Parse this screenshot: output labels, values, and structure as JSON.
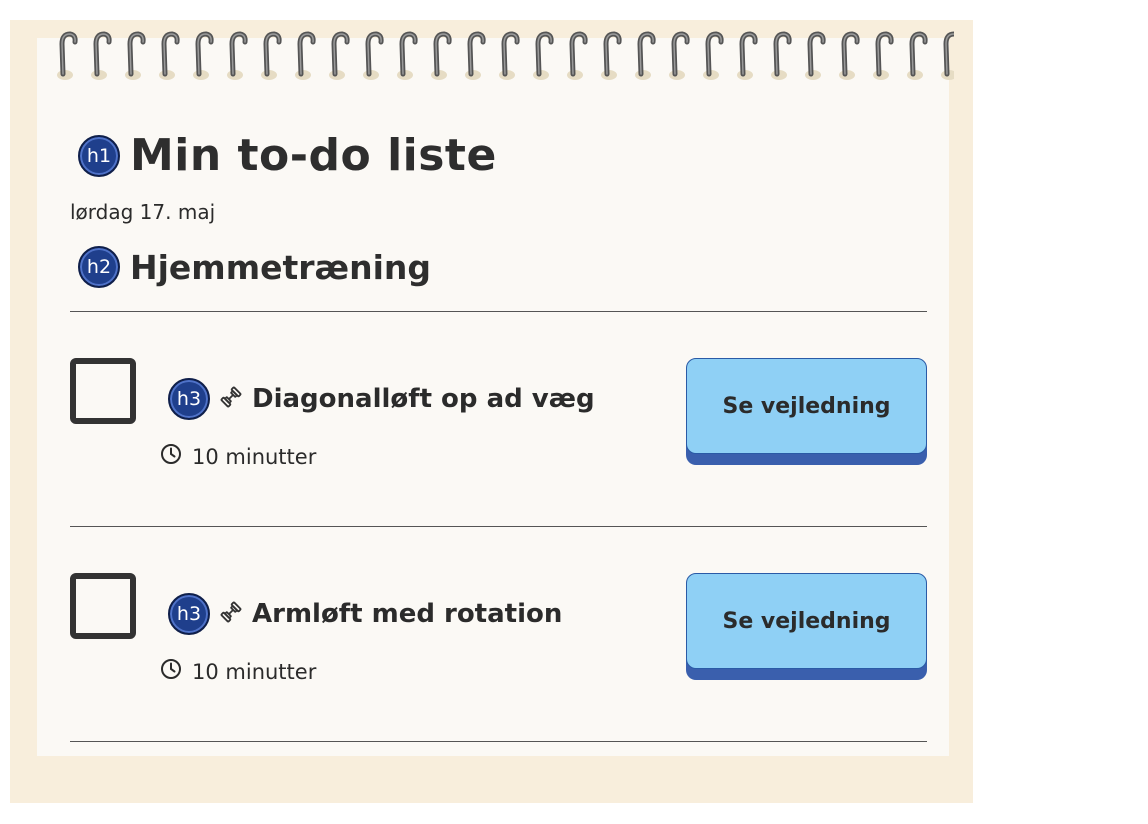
{
  "header": {
    "h1_badge": "h1",
    "title": "Min to-do liste",
    "date": "lørdag 17. maj",
    "h2_badge": "h2",
    "section_title": "Hjemmetræning"
  },
  "tasks": [
    {
      "badge": "h3",
      "title": "Diagonalløft op ad væg",
      "duration": "10 minutter",
      "button_label": "Se vejledning",
      "checked": false
    },
    {
      "badge": "h3",
      "title": "Armløft med rotation",
      "duration": "10 minutter",
      "button_label": "Se vejledning",
      "checked": false
    }
  ],
  "icons": {
    "task_icon": "dumbbell-icon",
    "time_icon": "clock-icon"
  },
  "colors": {
    "frame": "#f8eedc",
    "paper": "#fbf9f5",
    "button": "#8fd0f5",
    "button_shadow": "#3a5fad",
    "badge": "#1f3f8c"
  }
}
